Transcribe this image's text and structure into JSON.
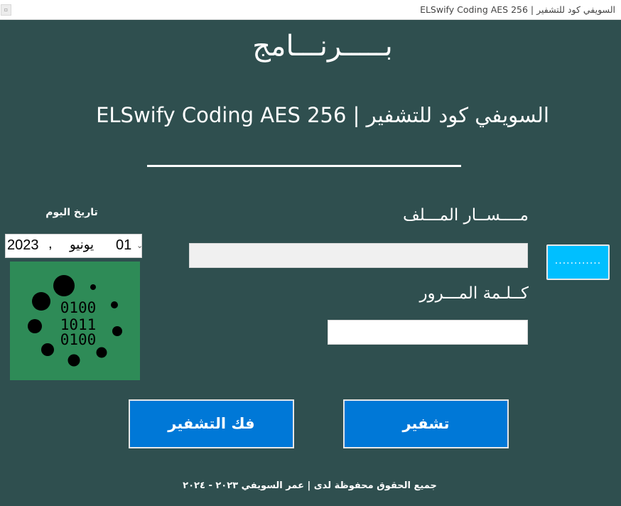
{
  "window": {
    "title": "السويفي كود للتشفير | ELSwify Coding AES 256",
    "system_icon": "app-menu-icon"
  },
  "header": {
    "program_word": "بـــــرنـــامج",
    "app_title": "السويفي كود للتشفير | ELSwify Coding AES 256"
  },
  "form": {
    "path_label": "مــــســار المـــلف",
    "path_value": "",
    "browse_label": "............",
    "password_label": "كــلـمة المـــرور",
    "password_value": ""
  },
  "date": {
    "label": "تاريخ اليوم",
    "year": "2023",
    "separator": ",",
    "month": "يونيو",
    "day": "01"
  },
  "logo": {
    "lines": [
      "0100",
      "1011",
      "0100"
    ],
    "icon": "binary-logo-icon"
  },
  "buttons": {
    "encrypt": "تشفير",
    "decrypt": "فك التشفير"
  },
  "footer": {
    "text": "جميع الحقوق محفوظة لدى | عمر السويفي ٢٠٢٣ - ٢٠٢٤"
  },
  "colors": {
    "background": "#2f4f4f",
    "button": "#0078d7",
    "browse_button": "#00bfff",
    "logo_bg": "#2e8b57"
  }
}
